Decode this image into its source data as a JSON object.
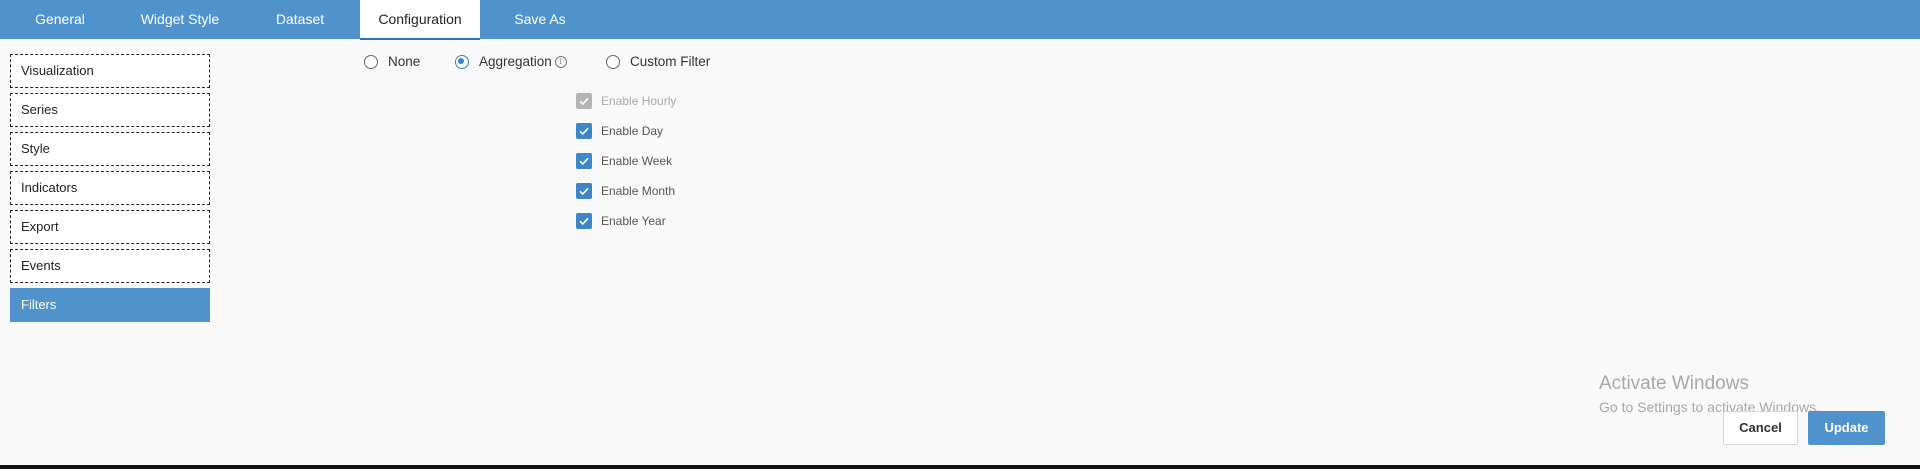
{
  "tabs": [
    {
      "label": "General"
    },
    {
      "label": "Widget Style"
    },
    {
      "label": "Dataset"
    },
    {
      "label": "Configuration",
      "active": true
    },
    {
      "label": "Save As"
    }
  ],
  "sidebar": {
    "items": [
      {
        "label": "Visualization"
      },
      {
        "label": "Series"
      },
      {
        "label": "Style"
      },
      {
        "label": "Indicators"
      },
      {
        "label": "Export"
      },
      {
        "label": "Events"
      },
      {
        "label": "Filters",
        "active": true
      }
    ]
  },
  "filter_mode": {
    "options": [
      {
        "label": "None",
        "checked": false
      },
      {
        "label": "Aggregation",
        "checked": true,
        "icon": "info-icon"
      },
      {
        "label": "Custom Filter",
        "checked": false
      }
    ]
  },
  "aggregation": {
    "options": [
      {
        "label": "Enable Hourly",
        "checked": true,
        "disabled": true
      },
      {
        "label": "Enable Day",
        "checked": true,
        "disabled": false
      },
      {
        "label": "Enable Week",
        "checked": true,
        "disabled": false
      },
      {
        "label": "Enable Month",
        "checked": true,
        "disabled": false
      },
      {
        "label": "Enable Year",
        "checked": true,
        "disabled": false
      }
    ]
  },
  "watermark": {
    "title": "Activate Windows",
    "subtitle": "Go to Settings to activate Windows."
  },
  "footer": {
    "cancel_label": "Cancel",
    "update_label": "Update"
  },
  "colors": {
    "accent": "#5092cc",
    "checkbox": "#3f86c6",
    "checkbox_disabled": "#b5b5b5",
    "background": "#f9f9f9"
  }
}
